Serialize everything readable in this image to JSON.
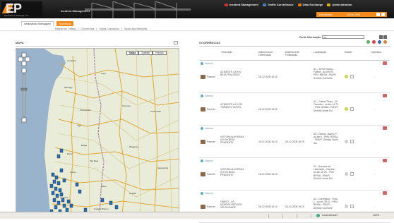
{
  "header": {
    "logo_text": "EP",
    "logo_sub": "Estradas de Portugal, S.A.",
    "app_title": "Incident Management",
    "nav": [
      {
        "label": "Incident Management",
        "color": "#c33"
      },
      {
        "label": "Traffic Surveillance",
        "color": "#4a7fc0"
      },
      {
        "label": "Data Exchange",
        "color": "#e07b1a"
      },
      {
        "label": "Administration",
        "color": "#d9b300"
      }
    ],
    "user": "Administrador",
    "date": "26-Dez-2008"
  },
  "tabs": {
    "tab1": "Infraestrutur Mensagem",
    "tab2": "Ocorrência",
    "subnav": [
      "Registo de Tráfego",
      "Ocorrências",
      "Dados Calculados",
      "Dados das Medições"
    ]
  },
  "fonte": {
    "label": "Fonte Informação",
    "value": "Ok"
  },
  "map": {
    "title": "MAPA",
    "types": [
      "Mapa",
      "Satélite",
      "Híbrido"
    ],
    "active_type": "Mapa"
  },
  "occ": {
    "title": "OCORRÊNCIAS",
    "icon_colors": [
      "#6a6",
      "#c44",
      "#36a",
      "#c84"
    ],
    "headers": {
      "desc": "Descrição",
      "obs": "Data/Hora de Observação",
      "fin": "Data/Hora de Finalização",
      "loc": "Localização",
      "est": "Estado",
      "op": "Operador"
    },
    "groups": [
      {
        "label": "Sistema",
        "row": {
          "tipo": "Parecer",
          "desc": "ACIDENTE c/4 Km BEJA PRUDENTE",
          "obs": "26-12-2008 16:30",
          "fin": "",
          "loc": "A1 - Torres Novas - Fátima - ao km 99 - PRV: BRISA - PMVR: Sentido Sul-Norte",
          "op": "-"
        }
      },
      {
        "label": "Sistema",
        "row": {
          "tipo": "Parecer",
          "desc": "ACIDENTE A 10 EM TRÂNSITO LENTO",
          "obs": "26-12-2008 16:25",
          "fin": "",
          "loc": "A3 - Gaens Times - Vil Francelo - ao km 14.75 - PMV: BRISA - PMVR: Sentido Norte-Sul",
          "op": "-"
        }
      },
      {
        "label": "Sistema",
        "row": {
          "tipo": "Parecer",
          "desc": "VISTURA ALVORADA A 5 Km BEJA PRUDENTE",
          "obs": "26-12-2008 16:20",
          "fin": "26-12-2008 16:25",
          "loc": "A5 - Oeiras - Baixa 2ª - ao km 6 - PMV: BRISA - PMVR: Sentido Norte-Sul",
          "op": "-"
        }
      },
      {
        "label": "Sistema",
        "row": {
          "tipo": "Parecer",
          "desc": "VISTURA ALVORADA A 5 Km BEJA PRUDENTE",
          "obs": "26-12-2008 16:15",
          "fin": "",
          "loc": "A1 - Avenida da Liberdade - Carnide - ao km 40.25 - PMV: BRISA - PMVR: Sentido Norte-Sul",
          "op": "-"
        }
      },
      {
        "label": "Sistema",
        "row": {
          "tipo": "Parecer",
          "desc": "OBSIST - AS MONTES REDUZIR VELOCIDADE",
          "obs": "26-12-2008 16:10",
          "fin": "26-12-2008 16:20",
          "loc": "A2 - Carregado - Porto 1 - ao km 18.41 - PMV: BRISA - PMVR: Sentido Sul-Norte",
          "op": "-"
        }
      }
    ]
  },
  "statusbar": {
    "zone": "Local intranet",
    "zoom": "100%"
  }
}
